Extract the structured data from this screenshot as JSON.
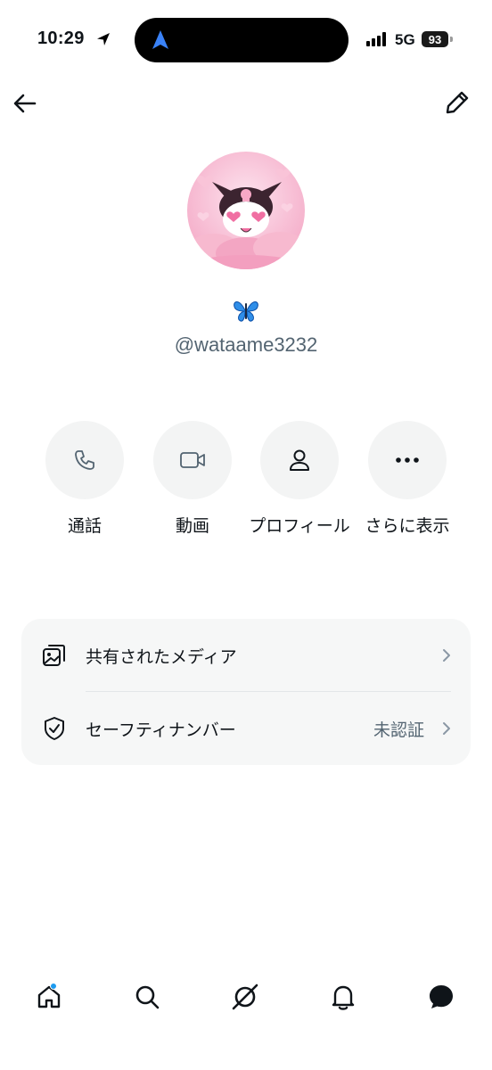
{
  "status_bar": {
    "time": "10:29",
    "network": "5G",
    "battery": "93"
  },
  "profile": {
    "display_name_emoji": "butterfly-emoji",
    "handle": "@wataame3232"
  },
  "actions": [
    {
      "label": "通話",
      "icon": "phone-icon"
    },
    {
      "label": "動画",
      "icon": "video-icon"
    },
    {
      "label": "プロフィール",
      "icon": "person-icon"
    },
    {
      "label": "さらに表示",
      "icon": "more-icon"
    }
  ],
  "settings": {
    "shared_media": {
      "label": "共有されたメディア",
      "icon": "media-icon"
    },
    "safety_number": {
      "label": "セーフティナンバー",
      "value": "未認証",
      "icon": "shield-check-icon"
    }
  },
  "bottom_nav": [
    "home-icon",
    "search-icon",
    "grok-icon",
    "bell-icon",
    "messages-icon"
  ],
  "colors": {
    "accent": "#1d9bf0",
    "text": "#0f1419",
    "secondary_text": "#536471",
    "card_bg": "#f6f7f7"
  }
}
